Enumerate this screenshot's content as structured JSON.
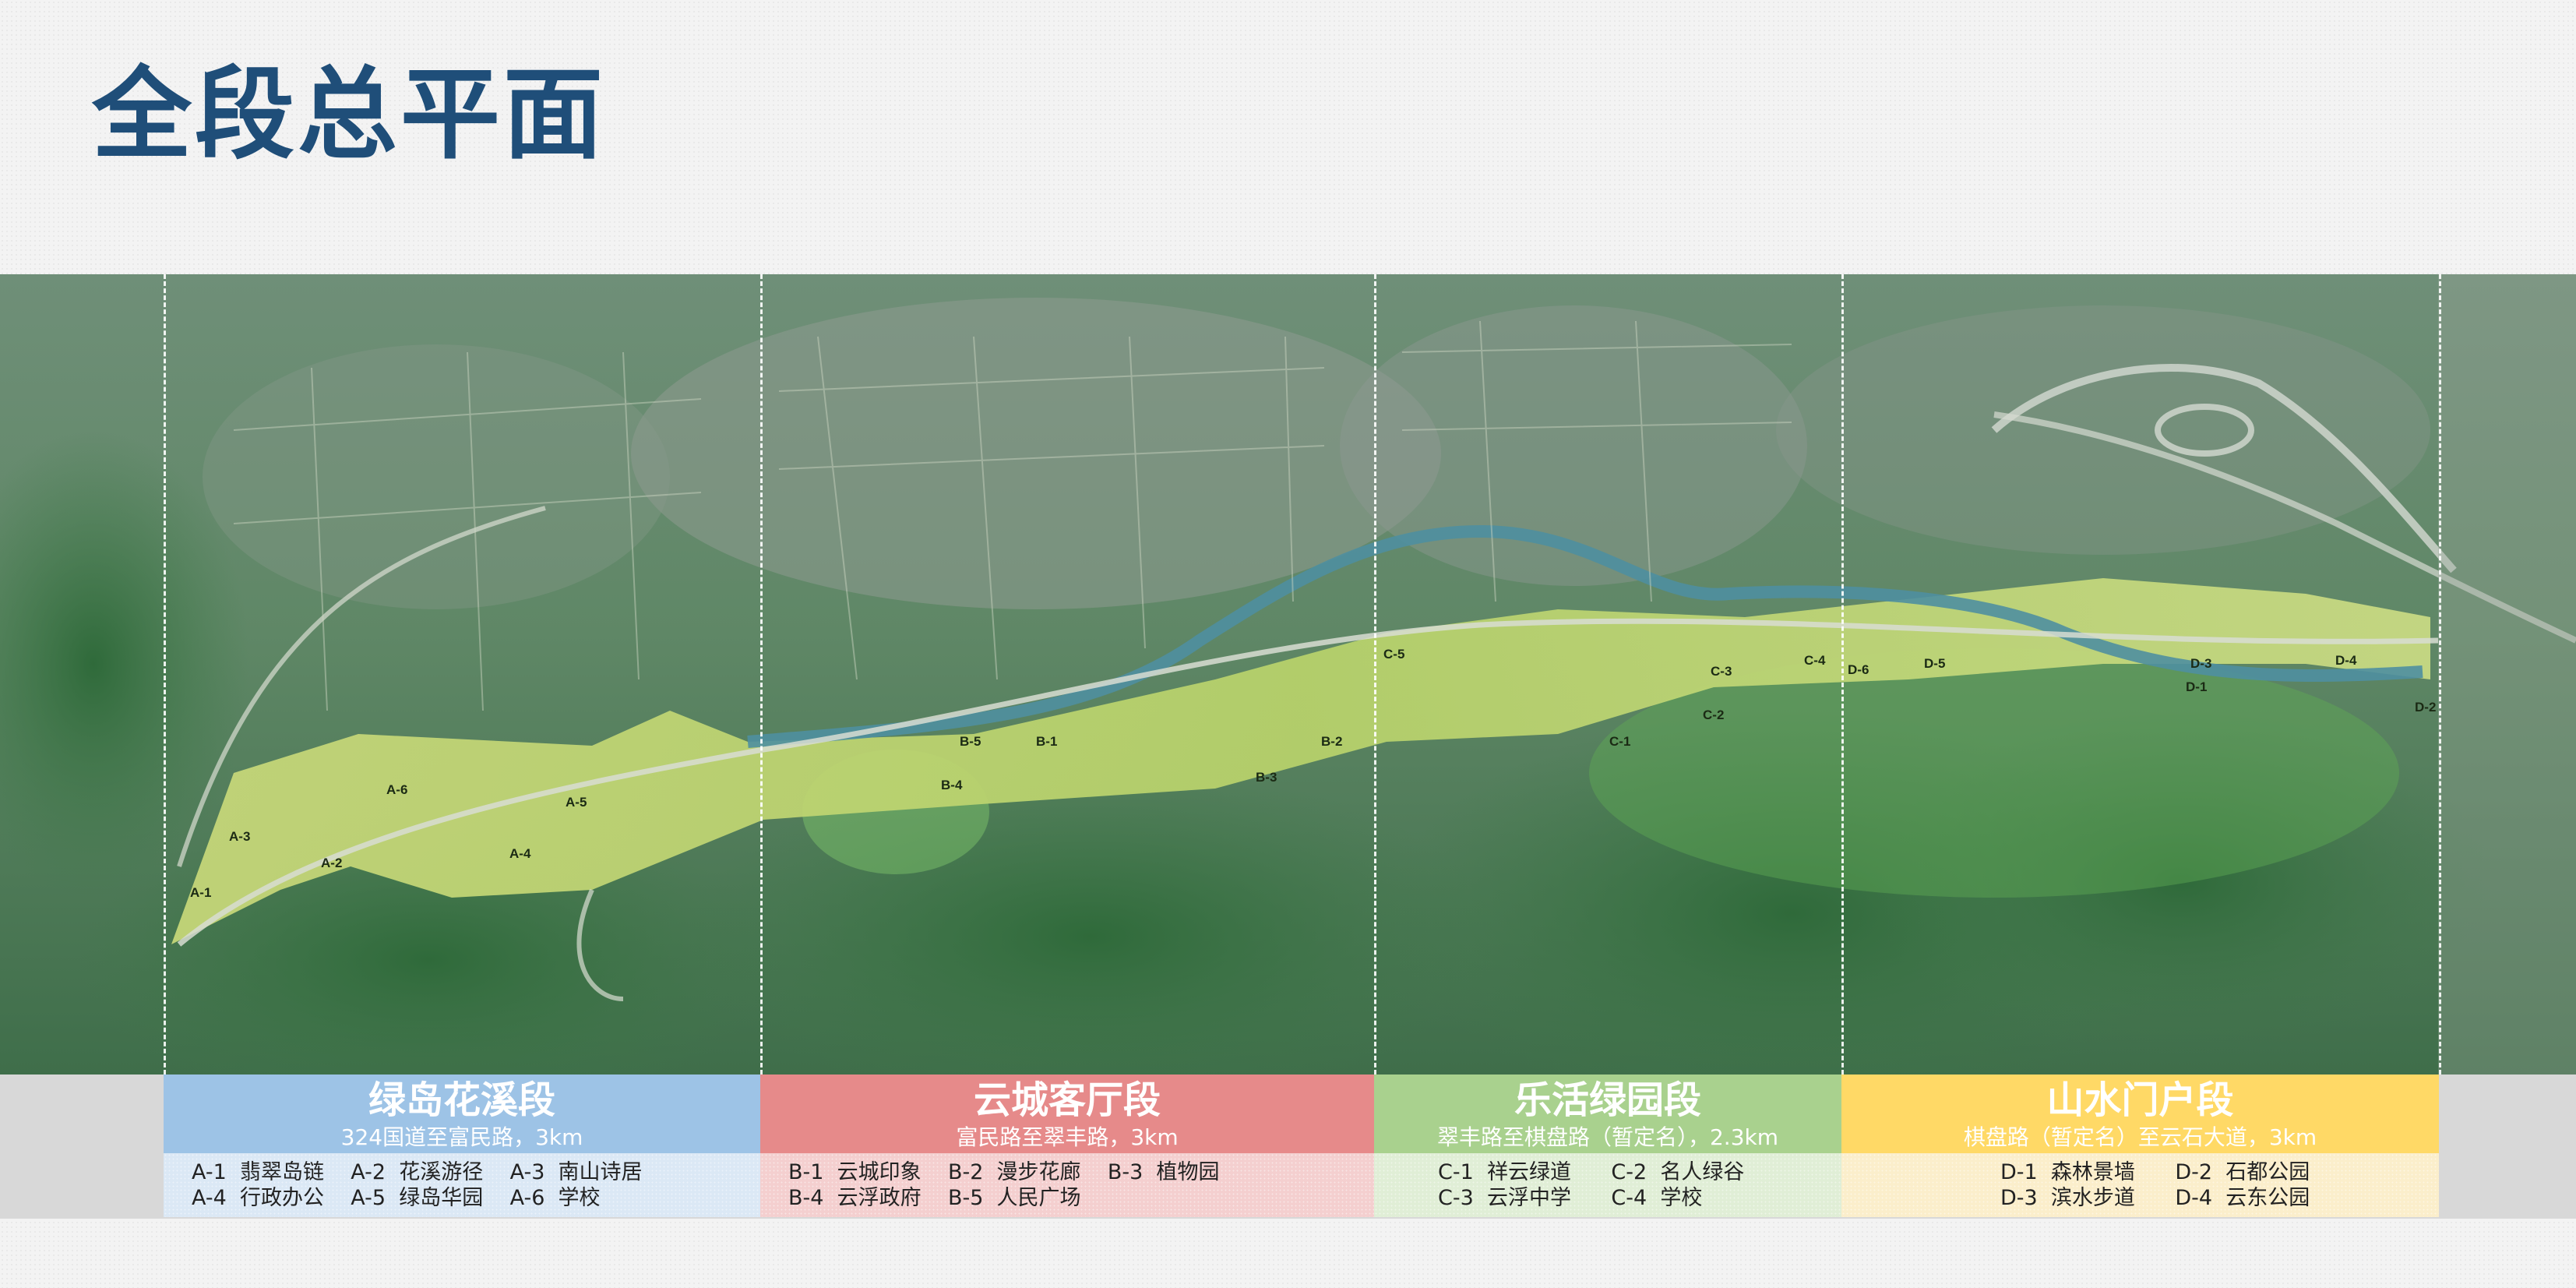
{
  "title": "全段总平面",
  "segments": [
    {
      "name": "绿岛花溪段",
      "route": "324国道至富民路，3km",
      "color": "#9dc3e6",
      "list_color": "#dbe8f5",
      "items_row1": "A-1  翡翠岛链    A-2  花溪游径    A-3  南山诗居",
      "items_row2": "A-4  行政办公    A-5  绿岛华园    A-6  学校"
    },
    {
      "name": "云城客厅段",
      "route": "富民路至翠丰路，3km",
      "color": "#e68a8a",
      "list_color": "#f4cfcf",
      "items_row1": "B-1  云城印象    B-2  漫步花廊    B-3  植物园",
      "items_row2": "B-4  云浮政府    B-5  人民广场"
    },
    {
      "name": "乐活绿园段",
      "route": "翠丰路至棋盘路（暂定名），2.3km",
      "color": "#a9d18e",
      "list_color": "#e0eed6",
      "items_row1": "C-1  祥云绿道      C-2  名人绿谷",
      "items_row2": "C-3  云浮中学      C-4  学校"
    },
    {
      "name": "山水门户段",
      "route": "棋盘路（暂定名）至云石大道，3km",
      "color": "#ffd966",
      "list_color": "#fbeecb",
      "items_row1": "D-1  森林景墙      D-2  石都公园",
      "items_row2": "D-3  滨水步道      D-4  云东公园"
    }
  ],
  "map_labels": [
    "A-1",
    "A-2",
    "A-3",
    "A-4",
    "A-5",
    "A-6",
    "B-1",
    "B-2",
    "B-3",
    "B-4",
    "B-5",
    "C-1",
    "C-2",
    "C-3",
    "C-4",
    "C-5",
    "D-1",
    "D-2",
    "D-3",
    "D-4",
    "D-5",
    "D-6"
  ]
}
